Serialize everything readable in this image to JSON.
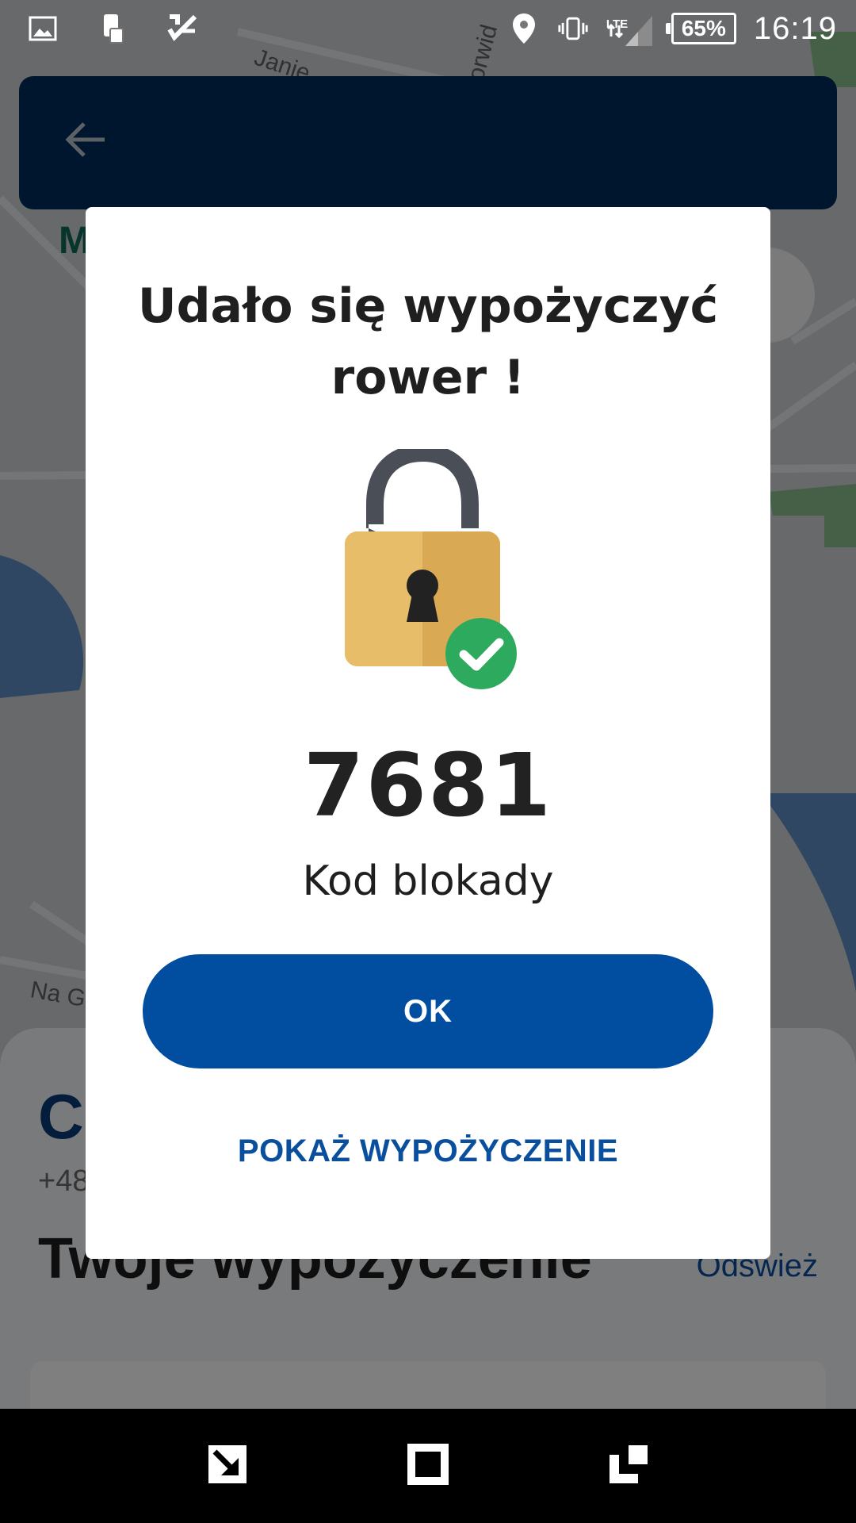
{
  "status_bar": {
    "battery_percent": "65%",
    "time": "16:19",
    "network": "LTE",
    "icons": [
      "image-icon",
      "sim-card-icon",
      "checklist-icon",
      "location-icon",
      "vibrate-icon",
      "signal-icon",
      "battery-icon"
    ]
  },
  "map": {
    "labels": [
      "Janie",
      "Norwid",
      "Na Gr",
      "M"
    ]
  },
  "app_bar": {
    "back_icon": "arrow-left-icon",
    "color": "#002d5c"
  },
  "sheet": {
    "name_partial": "Cz",
    "phone_partial": "+48",
    "section_title": "Twoje wypożyczenie",
    "refresh_label": "Odśwież"
  },
  "dialog": {
    "title": "Udało się wypożyczyć rower !",
    "lock_icon": "open-padlock-icon",
    "check_icon": "check-circle-icon",
    "code": "7681",
    "code_label": "Kod blokady",
    "ok_label": "OK",
    "show_rental_label": "POKAŻ WYPOŻYCZENIE",
    "button_color": "#014da0",
    "check_color": "#2eaa5e"
  },
  "nav_bar": {
    "icons": [
      "back-diagonal-icon",
      "home-square-icon",
      "recents-icon"
    ]
  }
}
